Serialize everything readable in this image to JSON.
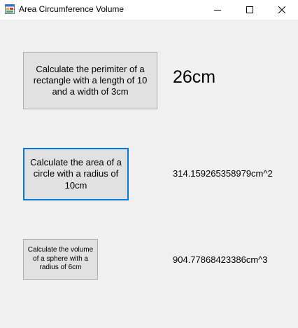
{
  "window": {
    "title": "Area Circumference Volume",
    "icon": "winforms-app-icon",
    "controls": {
      "minimize": "minimize-icon",
      "maximize": "maximize-icon",
      "close": "close-icon"
    }
  },
  "buttons": {
    "perimeter": {
      "label": "Calculate the perimiter of a rectangle with a length of 10 and a width of 3cm"
    },
    "area": {
      "label": "Calculate the area of a circle with a radius of 10cm"
    },
    "volume": {
      "label": "Calculate the volume of a sphere with a radius of 6cm"
    }
  },
  "results": {
    "perimeter": "26cm",
    "area": "314.159265358979cm^2",
    "volume": "904.77868423386cm^3"
  },
  "colors": {
    "focus": "#0078d7",
    "background": "#f0f0f0",
    "button": "#e1e1e1"
  }
}
